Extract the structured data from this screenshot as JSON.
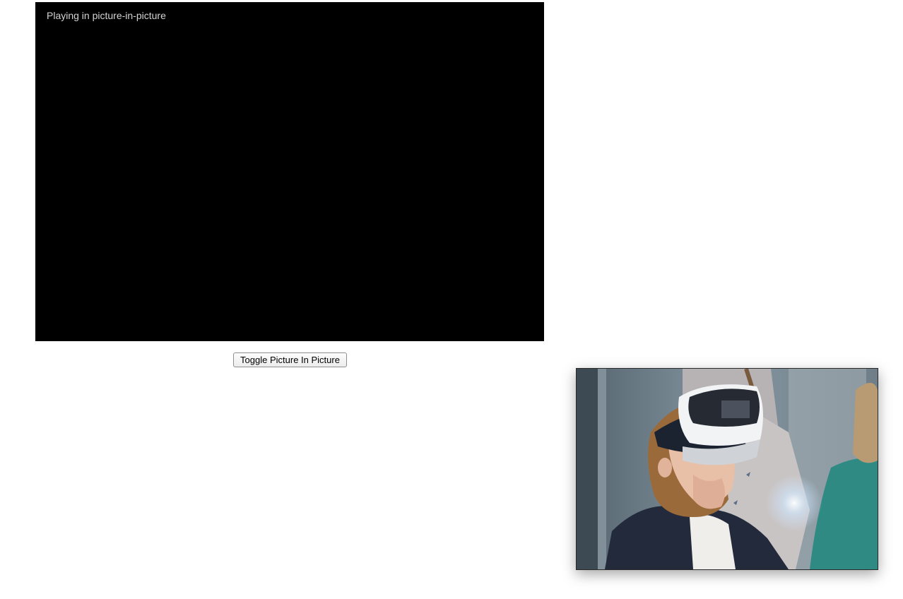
{
  "video": {
    "status_text": "Playing in picture-in-picture"
  },
  "controls": {
    "toggle_label": "Toggle Picture In Picture"
  },
  "pip": {
    "scene": "child-wearing-vr-headset"
  },
  "colors": {
    "video_background": "#000000",
    "page_background": "#ffffff",
    "status_text": "#d4d4d4"
  }
}
